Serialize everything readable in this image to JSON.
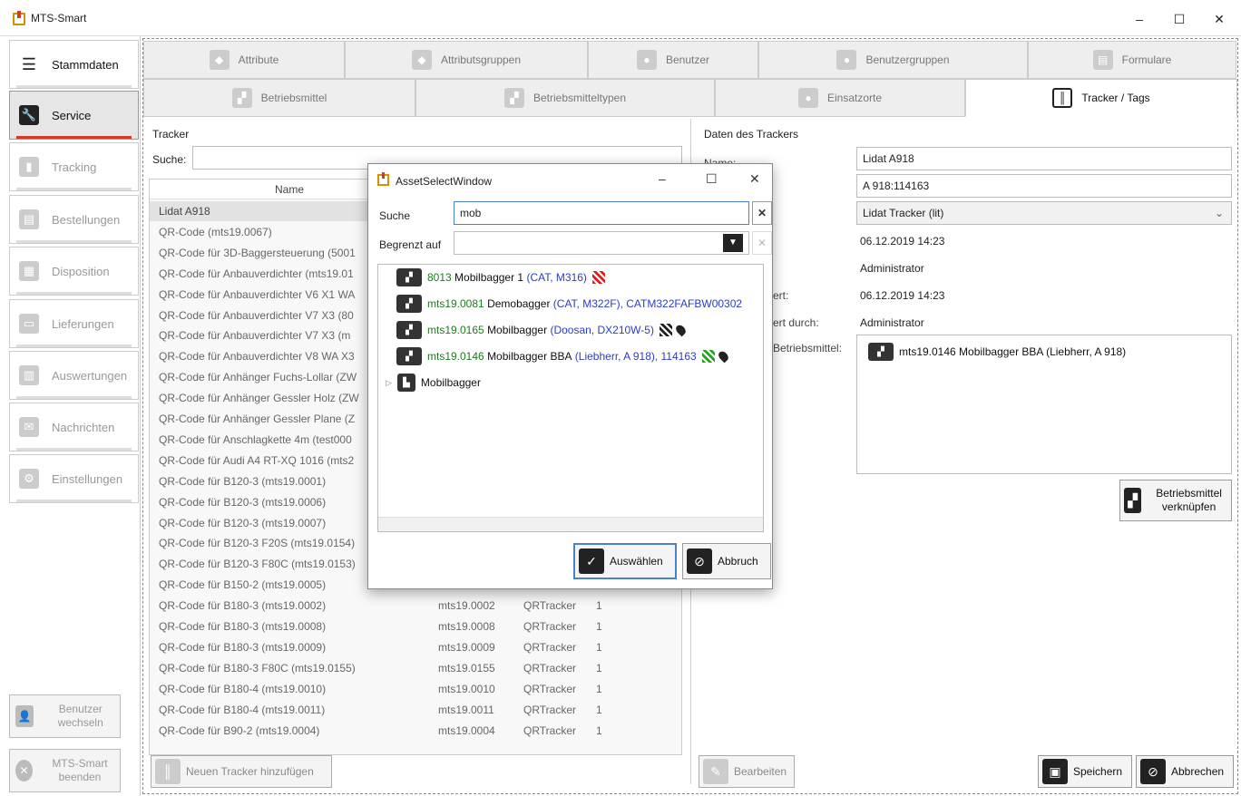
{
  "window": {
    "title": "MTS-Smart",
    "minimize": "–",
    "maximize": "☐",
    "close": "✕"
  },
  "sidebar": {
    "items": [
      {
        "label": "Stammdaten"
      },
      {
        "label": "Service"
      },
      {
        "label": "Tracking"
      },
      {
        "label": "Bestellungen"
      },
      {
        "label": "Disposition"
      },
      {
        "label": "Lieferungen"
      },
      {
        "label": "Auswertungen"
      },
      {
        "label": "Nachrichten"
      },
      {
        "label": "Einstellungen"
      }
    ],
    "switch_user": "Benutzer wechseln",
    "quit": "MTS-Smart beenden"
  },
  "tabs_row1": [
    {
      "label": "Attribute"
    },
    {
      "label": "Attributsgruppen"
    },
    {
      "label": "Benutzer"
    },
    {
      "label": "Benutzergruppen"
    },
    {
      "label": "Formulare"
    }
  ],
  "tabs_row2": [
    {
      "label": "Betriebsmittel"
    },
    {
      "label": "Betriebsmitteltypen"
    },
    {
      "label": "Einsatzorte"
    },
    {
      "label": "Tracker / Tags"
    }
  ],
  "tracker_panel": {
    "title": "Tracker",
    "search_label": "Suche:",
    "search_value": "",
    "col_name": "Name",
    "rows": [
      {
        "name": "Lidat A918",
        "code": "",
        "type": "",
        "count": ""
      },
      {
        "name": "QR-Code (mts19.0067)",
        "code": "",
        "type": "",
        "count": ""
      },
      {
        "name": "QR-Code für 3D-Baggersteuerung (5001",
        "code": "",
        "type": "",
        "count": ""
      },
      {
        "name": "QR-Code für Anbauverdichter (mts19.01",
        "code": "",
        "type": "",
        "count": ""
      },
      {
        "name": "QR-Code für Anbauverdichter V6 X1 WA",
        "code": "",
        "type": "",
        "count": ""
      },
      {
        "name": "QR-Code für Anbauverdichter V7 X3 (80",
        "code": "",
        "type": "",
        "count": ""
      },
      {
        "name": "QR-Code für Anbauverdichter V7 X3 (m",
        "code": "",
        "type": "",
        "count": ""
      },
      {
        "name": "QR-Code für Anbauverdichter V8 WA X3",
        "code": "",
        "type": "",
        "count": ""
      },
      {
        "name": "QR-Code für Anhänger Fuchs-Lollar (ZW",
        "code": "",
        "type": "",
        "count": ""
      },
      {
        "name": "QR-Code für Anhänger Gessler Holz (ZW",
        "code": "",
        "type": "",
        "count": ""
      },
      {
        "name": "QR-Code für Anhänger Gessler Plane (Z",
        "code": "",
        "type": "",
        "count": ""
      },
      {
        "name": "QR-Code für Anschlagkette 4m (test000",
        "code": "",
        "type": "",
        "count": ""
      },
      {
        "name": "QR-Code für Audi A4 RT-XQ 1016 (mts2",
        "code": "",
        "type": "",
        "count": ""
      },
      {
        "name": "QR-Code für B120-3 (mts19.0001)",
        "code": "",
        "type": "",
        "count": ""
      },
      {
        "name": "QR-Code für B120-3 (mts19.0006)",
        "code": "",
        "type": "",
        "count": ""
      },
      {
        "name": "QR-Code für B120-3 (mts19.0007)",
        "code": "",
        "type": "",
        "count": ""
      },
      {
        "name": "QR-Code für B120-3 F20S (mts19.0154)",
        "code": "",
        "type": "",
        "count": ""
      },
      {
        "name": "QR-Code für B120-3 F80C (mts19.0153)",
        "code": "",
        "type": "",
        "count": ""
      },
      {
        "name": "QR-Code für B150-2 (mts19.0005)",
        "code": "",
        "type": "",
        "count": ""
      },
      {
        "name": "QR-Code für B180-3 (mts19.0002)",
        "code": "mts19.0002",
        "type": "QRTracker",
        "count": "1"
      },
      {
        "name": "QR-Code für B180-3 (mts19.0008)",
        "code": "mts19.0008",
        "type": "QRTracker",
        "count": "1"
      },
      {
        "name": "QR-Code für B180-3 (mts19.0009)",
        "code": "mts19.0009",
        "type": "QRTracker",
        "count": "1"
      },
      {
        "name": "QR-Code für B180-3 F80C (mts19.0155)",
        "code": "mts19.0155",
        "type": "QRTracker",
        "count": "1"
      },
      {
        "name": "QR-Code für B180-4 (mts19.0010)",
        "code": "mts19.0010",
        "type": "QRTracker",
        "count": "1"
      },
      {
        "name": "QR-Code für B180-4 (mts19.0011)",
        "code": "mts19.0011",
        "type": "QRTracker",
        "count": "1"
      },
      {
        "name": "QR-Code für B90-2 (mts19.0004)",
        "code": "mts19.0004",
        "type": "QRTracker",
        "count": "1"
      }
    ],
    "add_button": "Neuen Tracker hinzufügen"
  },
  "details": {
    "title": "Daten des Trackers",
    "name_label": "Name:",
    "name_value": "Lidat A918",
    "id_value": "A 918:114163",
    "type_value": "Lidat Tracker (lit)",
    "created_value": "06.12.2019 14:23",
    "created_by_value": "Administrator",
    "changed_label": "ert:",
    "changed_value": "06.12.2019 14:23",
    "changed_by_label": "ert durch:",
    "changed_by_value": "Administrator",
    "asset_label": "Betriebsmittel:",
    "asset_value": "mts19.0146 Mobilbagger BBA (Liebherr, A 918)",
    "link_button": "Betriebsmittel verknüpfen",
    "edit_button": "Bearbeiten",
    "save_button": "Speichern",
    "cancel_button": "Abbrechen"
  },
  "dialog": {
    "title": "AssetSelectWindow",
    "search_label": "Suche",
    "search_value": "mob",
    "limit_label": "Begrenzt auf",
    "limit_value": "",
    "items": [
      {
        "code": "8013",
        "name": "Mobilbagger 1",
        "meta": "(CAT, M316)"
      },
      {
        "code": "mts19.0081",
        "name": "Demobagger",
        "meta": "(CAT, M322F), CATM322FAFBW00302"
      },
      {
        "code": "mts19.0165",
        "name": "Mobilbagger",
        "meta": "(Doosan, DX210W-5)"
      },
      {
        "code": "mts19.0146",
        "name": "Mobilbagger BBA",
        "meta": "(Liebherr, A 918), 114163"
      }
    ],
    "group": "Mobilbagger",
    "select_button": "Auswählen",
    "abort_button": "Abbruch"
  }
}
